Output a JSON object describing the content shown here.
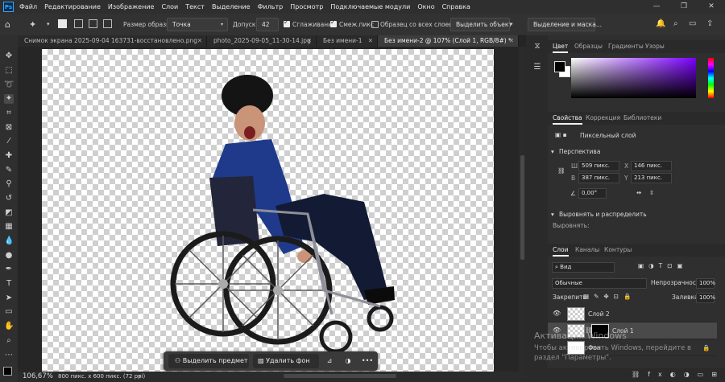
{
  "menu": {
    "app_icon": "photoshop-icon",
    "items": [
      "Файл",
      "Редактирование",
      "Изображение",
      "Слои",
      "Текст",
      "Выделение",
      "Фильтр",
      "Просмотр",
      "Подключаемые модули",
      "Окно",
      "Справка"
    ],
    "window_controls": [
      "—",
      "❐",
      "✕"
    ]
  },
  "options": {
    "sample_size_label": "Размер образца:",
    "sample_size_value": "Точка",
    "tolerance_label": "Допуск:",
    "tolerance_value": "42",
    "antialias_label": "Сглаживание",
    "contiguous_label": "Смеж.пикс",
    "all_layers_label": "Образец со всех слоев",
    "select_subject": "Выделить объект",
    "select_mask": "Выделение и маска..."
  },
  "tabs": [
    {
      "label": "Снимок экрана 2025-09-04 163731-восстановлено.png",
      "close": "✕"
    },
    {
      "label": "photo_2025-09-05_11-30-14.jpg",
      "close": "✕"
    },
    {
      "label": "Без имени-1",
      "close": "✕"
    },
    {
      "label": "Без имени-2 @ 107% (Слой 1, RGB/8#) *",
      "close": "✕"
    }
  ],
  "status": {
    "zoom": "106,67%",
    "doc_info": "800 пикс. x 600 пикс. (72 ppi)",
    "arrow": "›"
  },
  "context_bar": {
    "select_subject": "Выделить предмет",
    "remove_bg": "Удалить фон",
    "more": "•••"
  },
  "color_panel": {
    "tabs": [
      "Цвет",
      "Образцы",
      "Градиенты",
      "Узоры"
    ],
    "fg": "#000000",
    "bg": "#ffffff",
    "hue": "#7b00ff"
  },
  "properties": {
    "tabs": [
      "Свойства",
      "Коррекция",
      "Библиотеки"
    ],
    "kind": "Пиксельный слой",
    "section_transform": "Перспектива",
    "w_label": "Ш",
    "w_value": "509 пикс.",
    "x_label": "X",
    "x_value": "146 пикс.",
    "h_label": "В",
    "h_value": "387 пикс.",
    "y_label": "Y",
    "y_value": "213 пикс.",
    "angle": "0,00°",
    "section_align": "Выровнять и распределить",
    "align_label": "Выровнять:"
  },
  "layers": {
    "tabs": [
      "Слои",
      "Каналы",
      "Контуры"
    ],
    "filter": "Вид",
    "blend": "Обычные",
    "opacity_label": "Непрозрачность:",
    "opacity_value": "100%",
    "lock_label": "Закрепить:",
    "fill_label": "Заливка:",
    "fill_value": "100%",
    "items": [
      {
        "name": "Слой 2",
        "visible": true,
        "selected": false
      },
      {
        "name": "Слой 1",
        "visible": true,
        "selected": true
      },
      {
        "name": "Фон",
        "visible": false,
        "selected": false
      }
    ]
  },
  "watermark": {
    "line1": "Активация Windows",
    "line2": "Чтобы активировать Windows, перейдите в",
    "line3": "раздел \"Параметры\"."
  }
}
